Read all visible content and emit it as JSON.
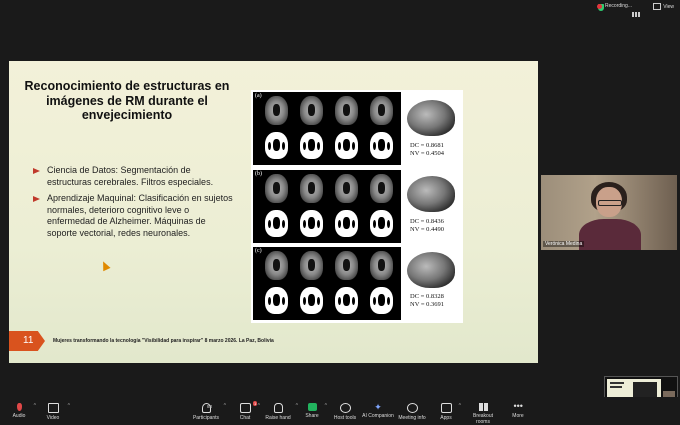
{
  "top_bar": {
    "recording_label": "Recording...",
    "view_label": "View"
  },
  "slide": {
    "title": "Reconocimiento de estructuras en imágenes de RM durante el envejecimiento",
    "bullets": [
      {
        "text": "Ciencia de Datos: Segmentación de estructuras cerebrales. Filtros especiales."
      },
      {
        "text": "Aprendizaje Maquinal: Clasificación en sujetos normales, deterioro cognitivo leve o enfermedad de Alzheimer. Máquinas de soporte vectorial, redes neuronales."
      }
    ],
    "page_number": "11",
    "footer": "Mujeres transformando la tecnología \"Visibilidad para inspirar\" 8 marzo 2026. La Paz, Bolivia",
    "accent_color": "#d9531e",
    "bullet_color": "#c0392b",
    "figure_panels": [
      {
        "label": "(a)",
        "dc": "DC = 0.8681",
        "nv": "NV = 0.4504"
      },
      {
        "label": "(b)",
        "dc": "DC = 0.8436",
        "nv": "NV = 0.4490"
      },
      {
        "label": "(c)",
        "dc": "DC = 0.8328",
        "nv": "NV = 0.3691"
      }
    ]
  },
  "participant": {
    "name": "Verónica Medina"
  },
  "toolbar": {
    "audio": "Audio",
    "video": "Video",
    "participants": "Participants",
    "participants_count": "83",
    "chat": "Chat",
    "chat_badge": "1",
    "raise_hand": "Raise hand",
    "share": "Share",
    "host_tools": "Host tools",
    "ai_companion": "AI Companion",
    "meeting_info": "Meeting info",
    "apps": "Apps",
    "breakout_rooms": "Breakout rooms",
    "more": "More"
  }
}
